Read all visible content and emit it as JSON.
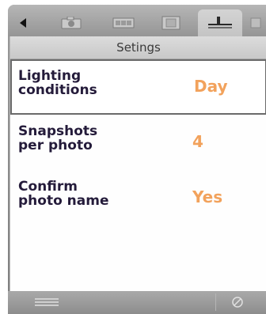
{
  "screen": {
    "title": "Setings"
  },
  "tabs": [
    {
      "icon": "camera-icon",
      "active": false
    },
    {
      "icon": "film-icon",
      "active": false
    },
    {
      "icon": "frame-icon",
      "active": false
    },
    {
      "icon": "settings-sliders-icon",
      "active": true
    },
    {
      "icon": "extra-tab-icon",
      "active": false
    }
  ],
  "settings": [
    {
      "label_line1": "Lighting",
      "label_line2": "conditions",
      "value": "Day",
      "selected": true
    },
    {
      "label_line1": "Snapshots",
      "label_line2": "per photo",
      "value": "4",
      "selected": false
    },
    {
      "label_line1": "Confirm",
      "label_line2": "photo name",
      "value": "Yes",
      "selected": false
    }
  ],
  "bottom": {
    "left_icon": "menu-icon",
    "right_icon": "cancel-icon"
  },
  "colors": {
    "value_text": "#f2a25c",
    "label_text": "#241b3a"
  }
}
